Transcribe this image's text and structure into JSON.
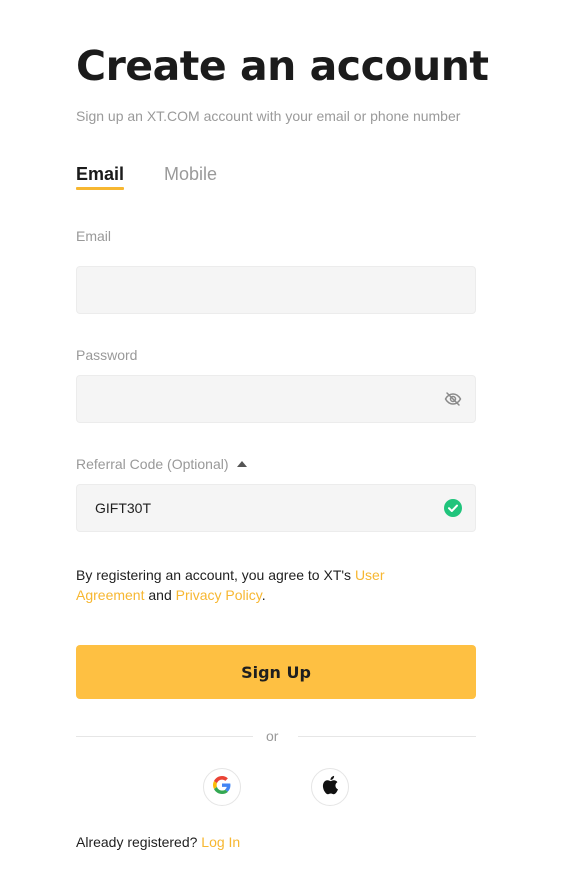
{
  "header": {
    "title": "Create an account",
    "subtitle": "Sign up an XT.COM account with your email or phone number"
  },
  "tabs": [
    {
      "label": "Email",
      "active": true
    },
    {
      "label": "Mobile",
      "active": false
    }
  ],
  "form": {
    "email": {
      "label": "Email",
      "value": "",
      "placeholder": ""
    },
    "password": {
      "label": "Password",
      "value": "",
      "placeholder": "",
      "visibility_icon": "eye-off-icon"
    },
    "referral": {
      "label": "Referral Code (Optional)",
      "value": "GIFT30T",
      "status_icon": "check-circle-icon"
    }
  },
  "agreement": {
    "prefix": "By registering an account, you agree to XT's ",
    "user_agreement": "User Agreement",
    "and": " and ",
    "privacy_policy": "Privacy Policy",
    "suffix": "."
  },
  "signup_button": "Sign Up",
  "divider_text": "or",
  "social": [
    {
      "name": "google-icon"
    },
    {
      "name": "apple-icon"
    }
  ],
  "footer": {
    "prefix": "Already registered? ",
    "login_link": "Log In"
  },
  "colors": {
    "accent": "#FEC042",
    "link": "#F7B731",
    "success": "#20C47C",
    "field_bg": "#F5F5F5"
  }
}
